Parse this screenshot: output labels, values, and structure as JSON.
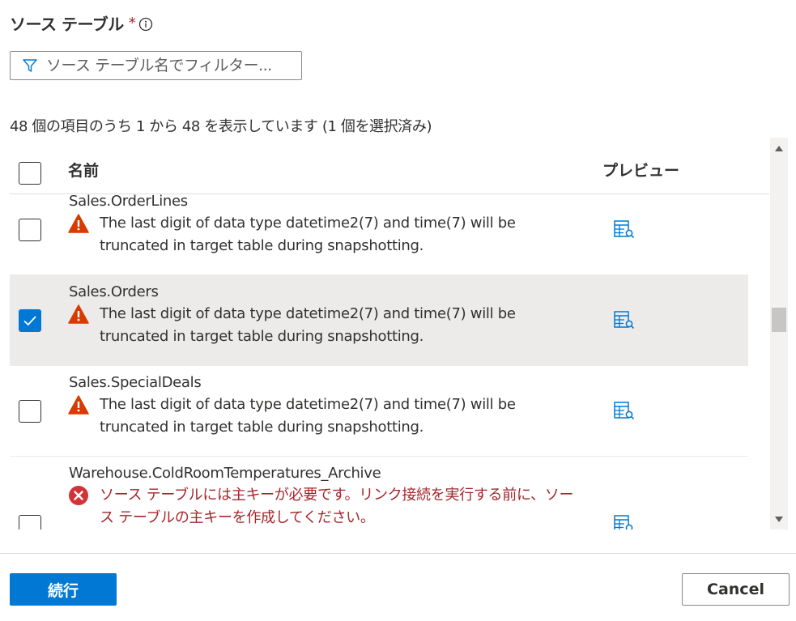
{
  "title": "ソース テーブル",
  "required_marker": "*",
  "filter": {
    "placeholder": "ソース テーブル名でフィルター..."
  },
  "summary": "48 個の項目のうち 1 から 48 を表示しています (1 個を選択済み)",
  "columns": {
    "name": "名前",
    "preview": "プレビュー"
  },
  "rows": [
    {
      "name": "Sales.OrderLines",
      "selected": false,
      "status": "warning",
      "message": "The last digit of data type datetime2(7) and time(7) will be truncated in target table during snapshotting."
    },
    {
      "name": "Sales.Orders",
      "selected": true,
      "status": "warning",
      "message": "The last digit of data type datetime2(7) and time(7) will be truncated in target table during snapshotting."
    },
    {
      "name": "Sales.SpecialDeals",
      "selected": false,
      "status": "warning",
      "message": "The last digit of data type datetime2(7) and time(7) will be truncated in target table during snapshotting."
    },
    {
      "name": "Warehouse.ColdRoomTemperatures_Archive",
      "selected": false,
      "status": "error",
      "message": "ソース テーブルには主キーが必要です。リンク接続を実行する前に、ソース テーブルの主キーを作成してください。"
    }
  ],
  "buttons": {
    "continue": "続行",
    "cancel": "Cancel"
  },
  "colors": {
    "accent": "#0078d4",
    "warning": "#d83b01",
    "error": "#d13438",
    "error_text": "#a4262c",
    "selected_row": "#edebe9"
  },
  "icons": {
    "info": "info-icon",
    "filter": "filter-icon",
    "warning": "warning-icon",
    "error": "error-icon",
    "preview": "table-preview-icon"
  }
}
